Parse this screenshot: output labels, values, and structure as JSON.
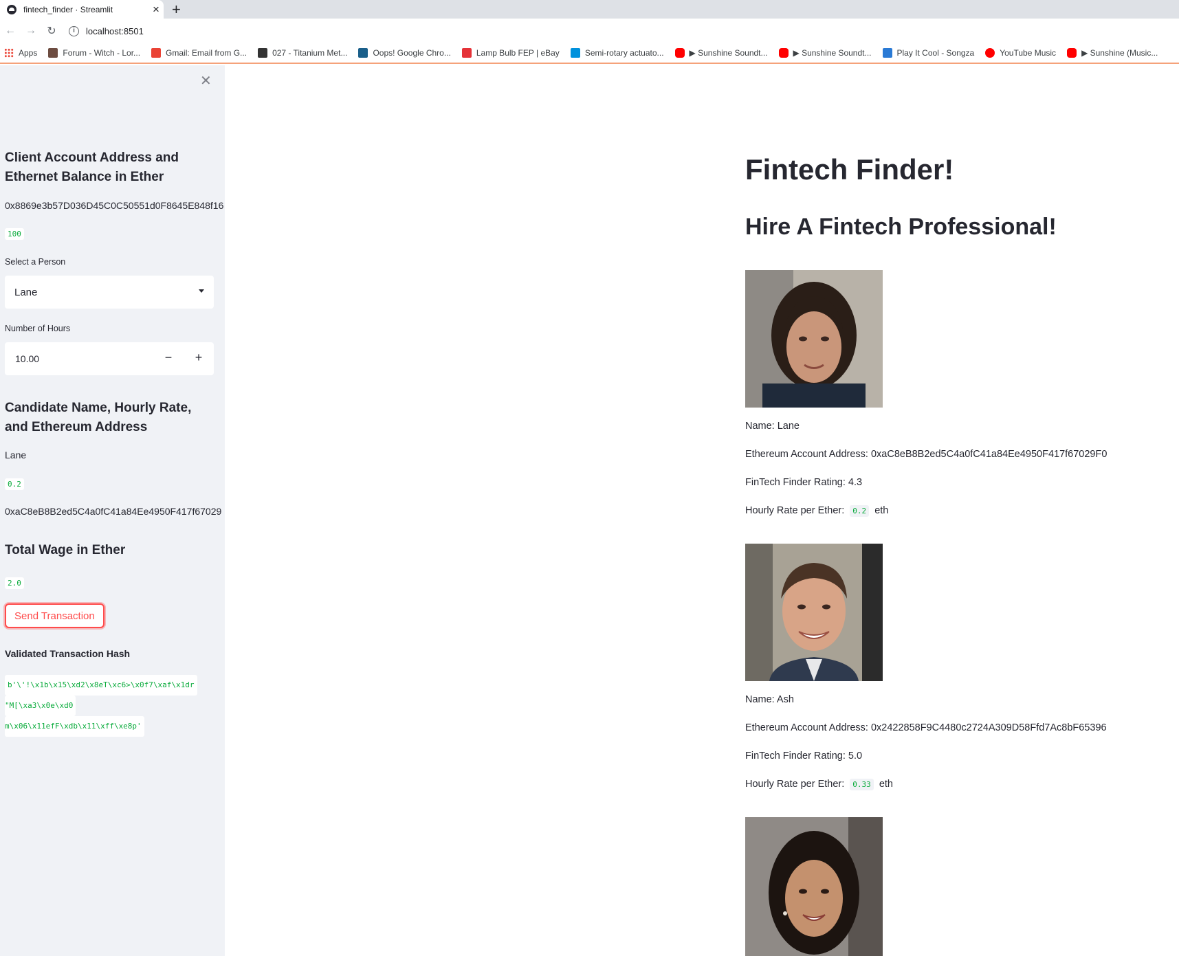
{
  "browser": {
    "tab_title": "fintech_finder · Streamlit",
    "url": "localhost:8501",
    "bookmarks": [
      {
        "label": "Apps",
        "icon": "apps-grid-icon",
        "color": "#ea4335"
      },
      {
        "label": "Forum - Witch - Lor...",
        "icon": "witch-hat-icon",
        "color": "#6d4c41"
      },
      {
        "label": "Gmail: Email from G...",
        "icon": "gmail-icon",
        "color": "#ea4335"
      },
      {
        "label": "027 - Titanium Met...",
        "icon": "titanium-icon",
        "color": "#333333"
      },
      {
        "label": "Oops! Google Chro...",
        "icon": "osti-icon",
        "color": "#1a5f8a"
      },
      {
        "label": "Lamp Bulb FEP | eBay",
        "icon": "ebay-bag-icon",
        "color": "#e53238"
      },
      {
        "label": "Semi-rotary actuato...",
        "icon": "festo-icon",
        "color": "#0091dc"
      },
      {
        "label": "▶ Sunshine Soundt...",
        "icon": "youtube-icon",
        "color": "#ff0000"
      },
      {
        "label": "▶ Sunshine Soundt...",
        "icon": "youtube-icon",
        "color": "#ff0000"
      },
      {
        "label": "Play It Cool - Songza",
        "icon": "songza-icon",
        "color": "#2a7ad5"
      },
      {
        "label": "YouTube Music",
        "icon": "youtube-music-icon",
        "color": "#ff0000"
      },
      {
        "label": "▶ Sunshine (Music...",
        "icon": "youtube-icon",
        "color": "#ff0000"
      }
    ]
  },
  "sidebar": {
    "close_glyph": "✕",
    "account_heading": "Client Account Address and Ethernet Balance in Ether",
    "account_address": "0x8869e3b57D036D45C0C50551d0F8645E848f16",
    "account_balance": "100",
    "select_label": "Select a Person",
    "select_value": "Lane",
    "hours_label": "Number of Hours",
    "hours_value": "10.00",
    "hours_minus": "−",
    "hours_plus": "+",
    "candidate_heading": "Candidate Name, Hourly Rate, and Ethereum Address",
    "candidate_name": "Lane",
    "candidate_rate": "0.2",
    "candidate_address": "0xaC8eB8B2ed5C4a0fC41a84Ee4950F417f67029",
    "wage_heading": "Total Wage in Ether",
    "wage_value": "2.0",
    "send_button": "Send Transaction",
    "hash_heading": "Validated Transaction Hash",
    "hash_lines": [
      "b'\\'!\\x1b\\x15\\xd2\\x8eT\\xc6>\\x0f7\\xaf\\x1dr",
      "\"M[\\xa3\\x0e\\xd0",
      "m\\x06\\x11efF\\xdb\\x11\\xff\\xe8p'"
    ]
  },
  "main": {
    "title": "Fintech Finder!",
    "subtitle": "Hire A Fintech Professional!",
    "candidates": [
      {
        "name_line": "Name: Lane",
        "address_line": "Ethereum Account Address: 0xaC8eB8B2ed5C4a0fC41a84Ee4950F417f67029F0",
        "rating_line": "FinTech Finder Rating: 4.3",
        "rate_label": "Hourly Rate per Ether:",
        "rate_value": "0.2",
        "rate_unit": "eth"
      },
      {
        "name_line": "Name: Ash",
        "address_line": "Ethereum Account Address: 0x2422858F9C4480c2724A309D58Ffd7Ac8bF65396",
        "rating_line": "FinTech Finder Rating: 5.0",
        "rate_label": "Hourly Rate per Ether:",
        "rate_value": "0.33",
        "rate_unit": "eth"
      }
    ]
  },
  "colors": {
    "accent": "#ff4b4b",
    "code_green": "#09ab3b",
    "sidebar_bg": "#f0f2f6",
    "text": "#262730"
  }
}
